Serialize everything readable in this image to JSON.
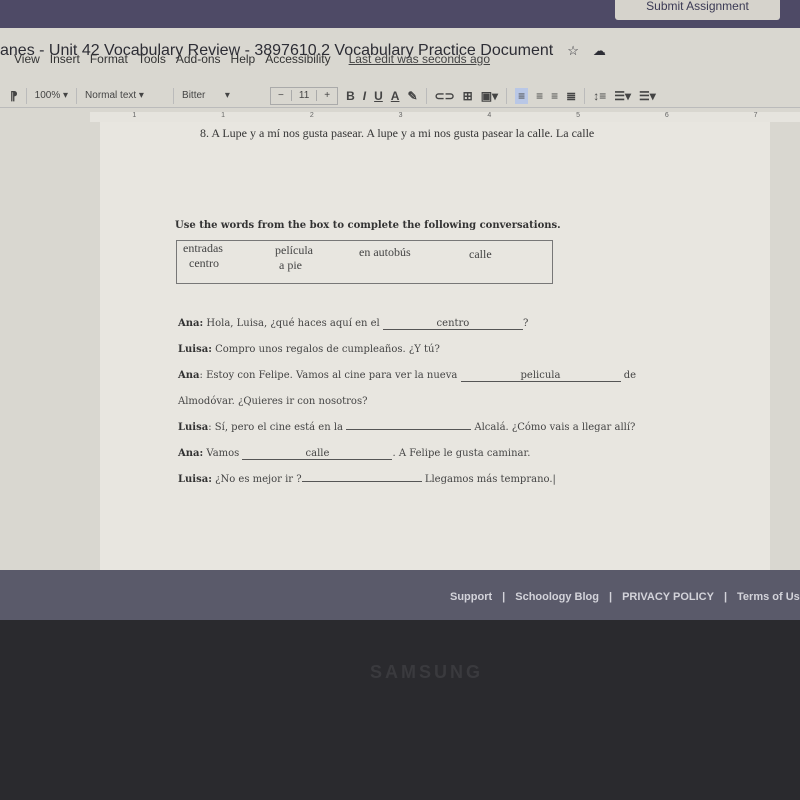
{
  "browser": {
    "submit_button": "Submit Assignment"
  },
  "docs": {
    "title": "anes - Unit 42 Vocabulary Review - 3897610.2 Vocabulary Practice Document",
    "star_icon": "☆",
    "cloud_icon": "☁",
    "menu": [
      "View",
      "Insert",
      "Format",
      "Tools",
      "Add-ons",
      "Help",
      "Accessibility"
    ],
    "last_edit": "Last edit was seconds ago",
    "toolbar": {
      "zoom": "100%",
      "style": "Normal text",
      "font": "Bitter",
      "font_size": "11",
      "minus": "−",
      "plus": "+",
      "bold": "B",
      "italic": "I",
      "underline": "U",
      "text_color": "A"
    },
    "ruler": [
      "1",
      "1",
      "2",
      "3",
      "4",
      "5",
      "6",
      "7"
    ]
  },
  "document": {
    "line8": "8.   A Lupe y a mí nos gusta pasear.  A lupe y a mi nos gusta pasear la calle. La calle",
    "instructions": "Use the words from the box to complete the following conversations.",
    "word_box": [
      "entradas",
      "centro",
      "película",
      "a pie",
      "en autobús",
      "calle"
    ],
    "conversation": [
      {
        "speaker": "Ana:",
        "before": "Hola, Luisa, ¿qué haces aquí en el",
        "answer": "centro",
        "after": "?"
      },
      {
        "speaker": "Luisa:",
        "before": "Compro unos regalos de cumpleaños. ¿Y tú?",
        "answer": "",
        "after": ""
      },
      {
        "speaker": "Ana",
        "before": ": Estoy con Felipe. Vamos al cine para ver la nueva",
        "answer": "pelicula",
        "after": "de"
      },
      {
        "speaker": "",
        "before": "Almodóvar. ¿Quieres ir con nosotros?",
        "answer": "",
        "after": ""
      },
      {
        "speaker": "Luisa",
        "before": ": Sí, pero el cine está en la",
        "answer": "",
        "after": "Alcalá. ¿Cómo vais a llegar allí?"
      },
      {
        "speaker": "Ana:",
        "before": "Vamos",
        "answer": "calle",
        "after": ". A Felipe le gusta caminar."
      },
      {
        "speaker": "Luisa:",
        "before": "¿No es mejor ir ?",
        "answer": "",
        "after": "Llegamos más temprano."
      }
    ]
  },
  "footer": {
    "links": [
      "Support",
      "Schoology Blog",
      "PRIVACY POLICY",
      "Terms of Use"
    ],
    "separator": "|"
  },
  "bezel_brand": "SAMSUNG"
}
